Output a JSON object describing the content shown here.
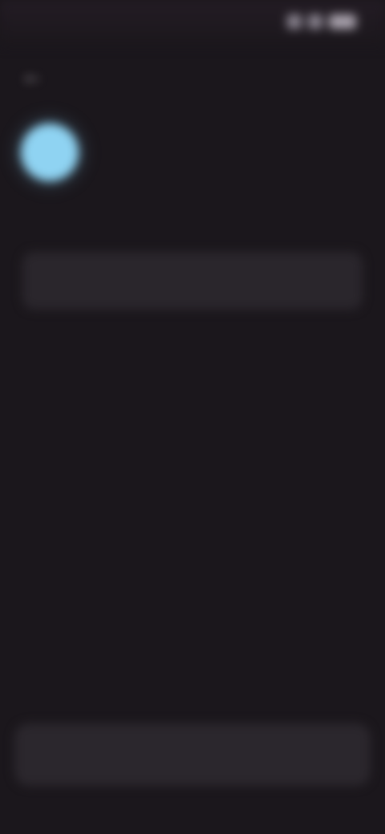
{
  "status_bar": {
    "time": "",
    "icons": [
      "signal-icon",
      "wifi-icon",
      "battery-icon"
    ]
  },
  "header": {
    "back_icon": "arrow-left-icon"
  },
  "profile": {
    "avatar_color": "#8fd3f2",
    "title": "",
    "subtitle": ""
  },
  "input": {
    "value": "",
    "placeholder": ""
  },
  "link": {
    "label": ""
  },
  "helper": {
    "text": "",
    "emphasis": ""
  },
  "primary_action": {
    "label": ""
  },
  "theme": {
    "background": "#1b171c",
    "surface": "#2a262c",
    "accent": "#7fb9ea"
  }
}
